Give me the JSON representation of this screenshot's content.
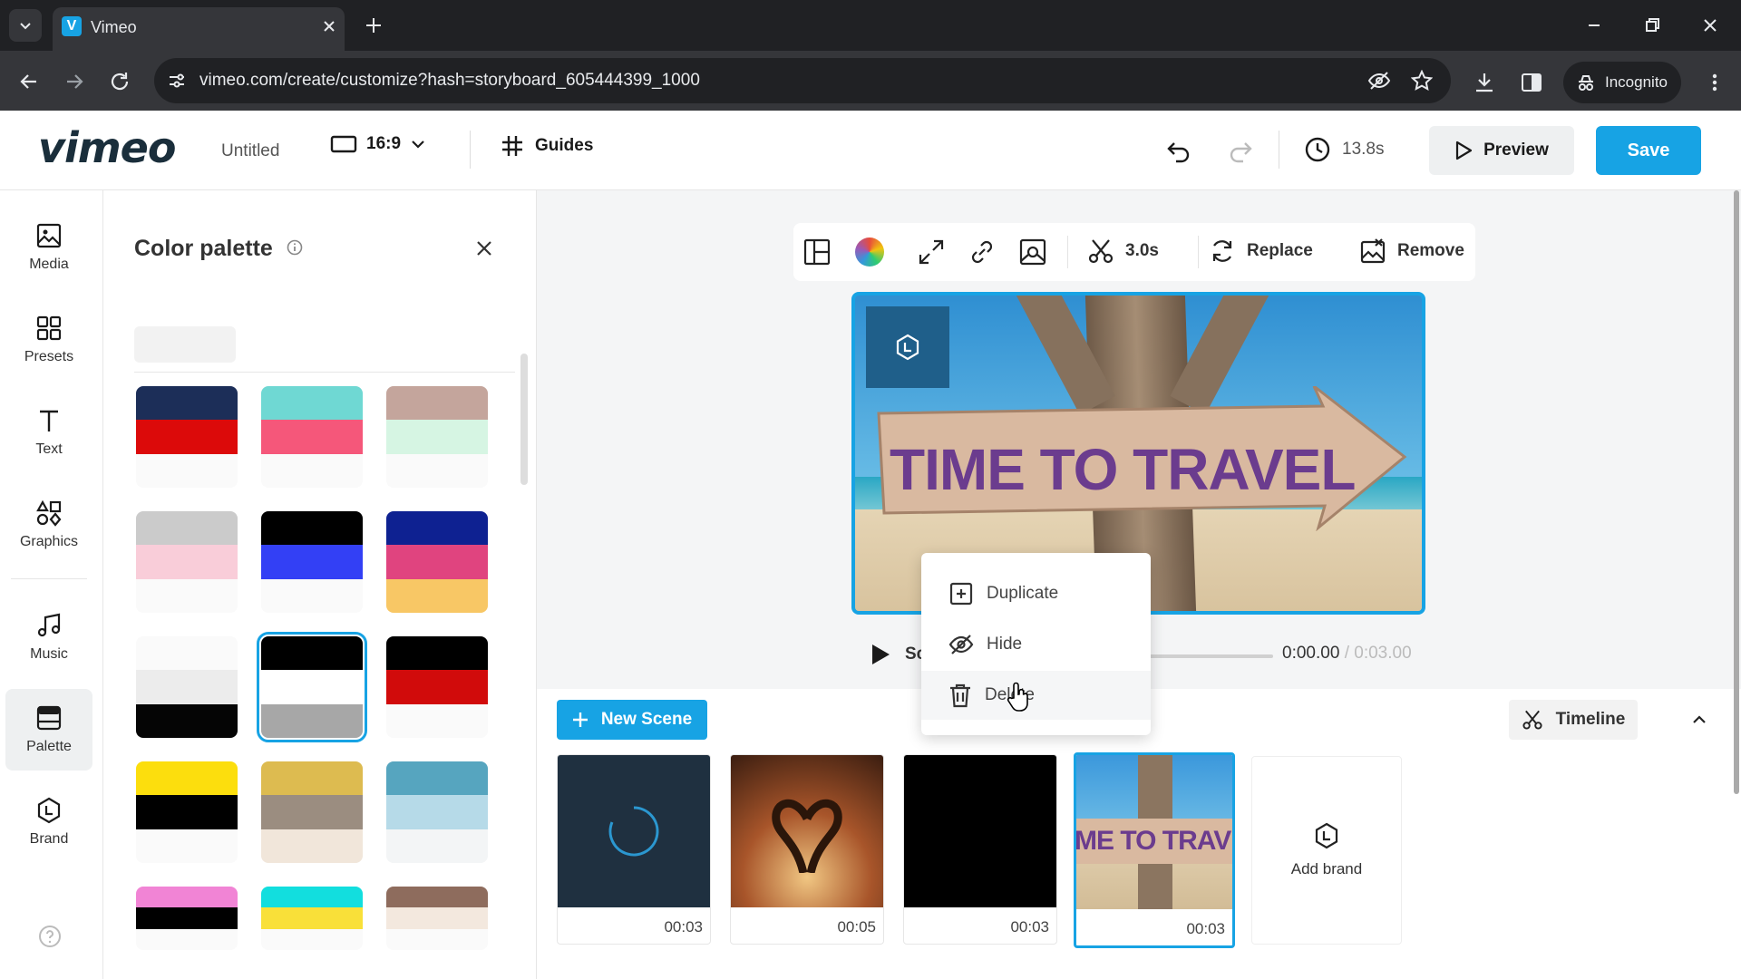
{
  "browser": {
    "tab_title": "Vimeo",
    "url": "vimeo.com/create/customize?hash=storyboard_605444399_1000",
    "incognito_label": "Incognito"
  },
  "header": {
    "logo": "vimeo",
    "project_title": "Untitled",
    "aspect_ratio": "16:9",
    "guides_label": "Guides",
    "duration": "13.8s",
    "preview_label": "Preview",
    "save_label": "Save"
  },
  "rail": {
    "items": [
      {
        "label": "Media",
        "icon": "image-icon"
      },
      {
        "label": "Presets",
        "icon": "grid-icon"
      },
      {
        "label": "Text",
        "icon": "text-icon"
      },
      {
        "label": "Graphics",
        "icon": "shapes-icon"
      },
      {
        "label": "Music",
        "icon": "music-icon"
      },
      {
        "label": "Palette",
        "icon": "palette-icon"
      },
      {
        "label": "Brand",
        "icon": "brand-icon"
      }
    ],
    "active": "Palette"
  },
  "panel": {
    "title": "Color palette",
    "palettes": [
      [
        "#1c2e58",
        "#dc0a0a",
        "#fafafa"
      ],
      [
        "#6fd8d3",
        "#f5577a",
        "#fafafa"
      ],
      [
        "#c4a59c",
        "#d6f5e3",
        "#fafafa"
      ],
      [
        "#cbcbcb",
        "#f9cdd9",
        "#fafafa"
      ],
      [
        "#000000",
        "#3340f5",
        "#fafafa"
      ],
      [
        "#0e2191",
        "#e0447f",
        "#f8c765"
      ],
      [
        "#fafafa",
        "#ececec",
        "#050505"
      ],
      [
        "#000000",
        "#ffffff",
        "#a7a7a7"
      ],
      [
        "#000000",
        "#d10b0b",
        "#fafafa"
      ],
      [
        "#fcde0d",
        "#000000",
        "#fafafa"
      ],
      [
        "#ddbb50",
        "#9b8d80",
        "#f1e6da"
      ],
      [
        "#56a5bf",
        "#b6dae8",
        "#f3f5f6"
      ],
      [
        "#f184d5",
        "#000000",
        "#fafafa"
      ],
      [
        "#12dede",
        "#f9e039",
        "#fafafa"
      ],
      [
        "#8e6c5d",
        "#f3e8de",
        "#fafafa"
      ]
    ],
    "selected_index": 7
  },
  "toolbar": {
    "trim_duration": "3.0s",
    "replace_label": "Replace",
    "remove_label": "Remove"
  },
  "preview": {
    "image_text": "TIME TO TRAVEL",
    "time_current": "0:00.00",
    "time_separator": "/",
    "time_total": "0:03.00",
    "scene_label_partial": "Sc"
  },
  "context_menu": {
    "items": [
      {
        "label": "Duplicate",
        "icon": "duplicate-icon"
      },
      {
        "label": "Hide",
        "icon": "eye-off-icon"
      },
      {
        "label": "Delete",
        "icon": "trash-icon"
      }
    ]
  },
  "scenes": {
    "new_scene_label": "New Scene",
    "timeline_label": "Timeline",
    "items": [
      {
        "duration": "00:03"
      },
      {
        "duration": "00:05"
      },
      {
        "duration": "00:03"
      },
      {
        "duration": "00:03",
        "thumb_text": "ME TO TRAVEL"
      }
    ],
    "add_brand_label": "Add brand"
  },
  "colors": {
    "accent": "#17a3e4",
    "save_bg": "#17a3e4"
  }
}
